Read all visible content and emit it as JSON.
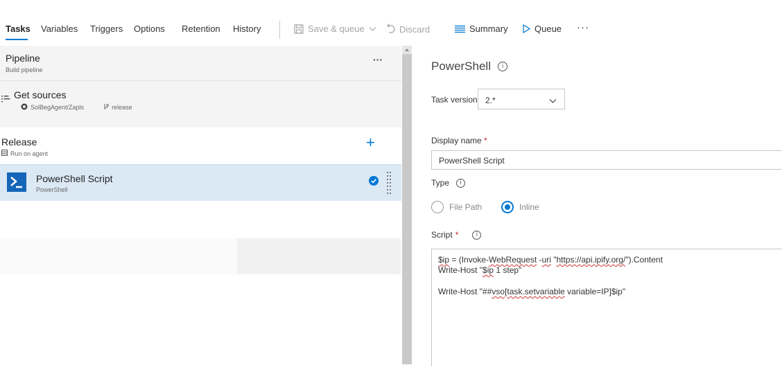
{
  "toolbar": {
    "tabs": [
      {
        "label": "Tasks",
        "active": true
      },
      {
        "label": "Variables"
      },
      {
        "label": "Triggers"
      },
      {
        "label": "Options"
      },
      {
        "label": "Retention"
      },
      {
        "label": "History"
      }
    ],
    "save_queue_label": "Save & queue",
    "discard_label": "Discard",
    "summary_label": "Summary",
    "queue_label": "Queue",
    "more_label": "···"
  },
  "pipeline": {
    "title": "Pipeline",
    "subtitle": "Build pipeline",
    "more_label": "···"
  },
  "get_sources": {
    "title": "Get sources",
    "repo": "SolBegAgent/Zapls",
    "branch": "release"
  },
  "release_job": {
    "title": "Release",
    "subtitle": "Run on agent",
    "add_label": "+"
  },
  "task": {
    "title": "PowerShell Script",
    "subtitle": "PowerShell"
  },
  "details": {
    "header": "PowerShell",
    "task_version_label": "Task version",
    "task_version_value": "2.*",
    "display_name_label": "Display name",
    "required_mark": "*",
    "display_name_value": "PowerShell Script",
    "type_label": "Type",
    "type_options": [
      {
        "label": "File Path",
        "selected": false
      },
      {
        "label": "Inline",
        "selected": true
      }
    ],
    "script_label": "Script",
    "script": {
      "l1_a": "$ip",
      "l1_b": " = (Invoke-",
      "l1_c": "WebRequest",
      "l1_d": " -",
      "l1_e": "uri",
      "l1_f": " \"",
      "l1_g": "https://api.ipify.org/",
      "l1_h": "\").Content",
      "l2_a": "Write-Host \"",
      "l2_b": "$ip",
      "l2_c": " 1 step\"",
      "l3_a": "Write-Host \"##",
      "l3_b": "vso",
      "l3_c": "[",
      "l3_d": "task.setvariable",
      "l3_e": " variable=IP]$ip\""
    }
  },
  "colors": {
    "accent": "#0078d4",
    "selected_row": "#dbe9f5",
    "gray_row": "#f4f4f4",
    "powershell_icon": "#1565b8",
    "required": "#c4262e"
  }
}
